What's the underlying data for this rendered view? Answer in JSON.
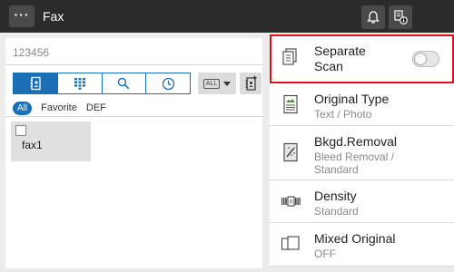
{
  "header": {
    "menu_label": "···",
    "title": "Fax",
    "icons": [
      "bell-icon",
      "fax-info-icon"
    ]
  },
  "destination": {
    "number": "123456"
  },
  "tabs": [
    {
      "name": "address-book-icon",
      "active": true
    },
    {
      "name": "keypad-icon",
      "active": false
    },
    {
      "name": "search-icon",
      "active": false
    },
    {
      "name": "history-icon",
      "active": false
    }
  ],
  "index_dropdown": {
    "value": "ALL"
  },
  "filters": {
    "all": "All",
    "favorite": "Favorite",
    "def": "DEF"
  },
  "destinations": [
    {
      "label": "fax1",
      "checked": false
    }
  ],
  "options": {
    "separate_scan": {
      "title": "Separate Scan",
      "enabled": false
    },
    "original_type": {
      "title": "Original Type",
      "value": "Text / Photo"
    },
    "bkgd_removal": {
      "title": "Bkgd.Removal",
      "value": "Bleed Removal / Standard"
    },
    "density": {
      "title": "Density",
      "value": "Standard"
    },
    "mixed_original": {
      "title": "Mixed Original",
      "value": "OFF"
    }
  },
  "colors": {
    "accent": "#1a6fb5",
    "highlight": "#e0111a",
    "header": "#2b2b2b"
  }
}
